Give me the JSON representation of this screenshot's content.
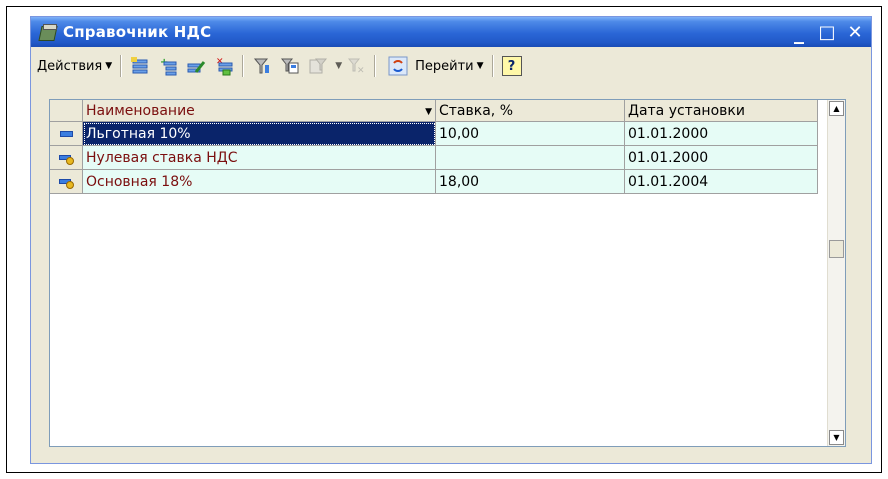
{
  "window": {
    "title": "Справочник НДС",
    "controls": [
      "_",
      "□",
      "✕"
    ]
  },
  "toolbar": {
    "actions_label": "Действия",
    "goto_label": "Перейти",
    "help_label": "?",
    "icons": [
      "add-item-icon",
      "add-group-icon",
      "edit-item-icon",
      "delete-item-icon",
      "filter-icon",
      "filter-by-value-icon",
      "filter-history-icon",
      "clear-filter-icon",
      "refresh-icon",
      "help-icon"
    ]
  },
  "grid": {
    "columns": [
      "Наименование",
      "Ставка, %",
      "Дата установки"
    ],
    "rows": [
      {
        "name": "Льготная 10%",
        "rate": "10,00",
        "date": "01.01.2000"
      },
      {
        "name": "Нулевая ставка НДС",
        "rate": "",
        "date": "01.01.2000"
      },
      {
        "name": "Основная 18%",
        "rate": "18,00",
        "date": "01.01.2004"
      }
    ]
  },
  "colors": {
    "title_bar": "#2a66d6",
    "row_bg": "#e6fcf6",
    "selected_bg": "#0a246a",
    "header_text": "#7b0f0f"
  }
}
